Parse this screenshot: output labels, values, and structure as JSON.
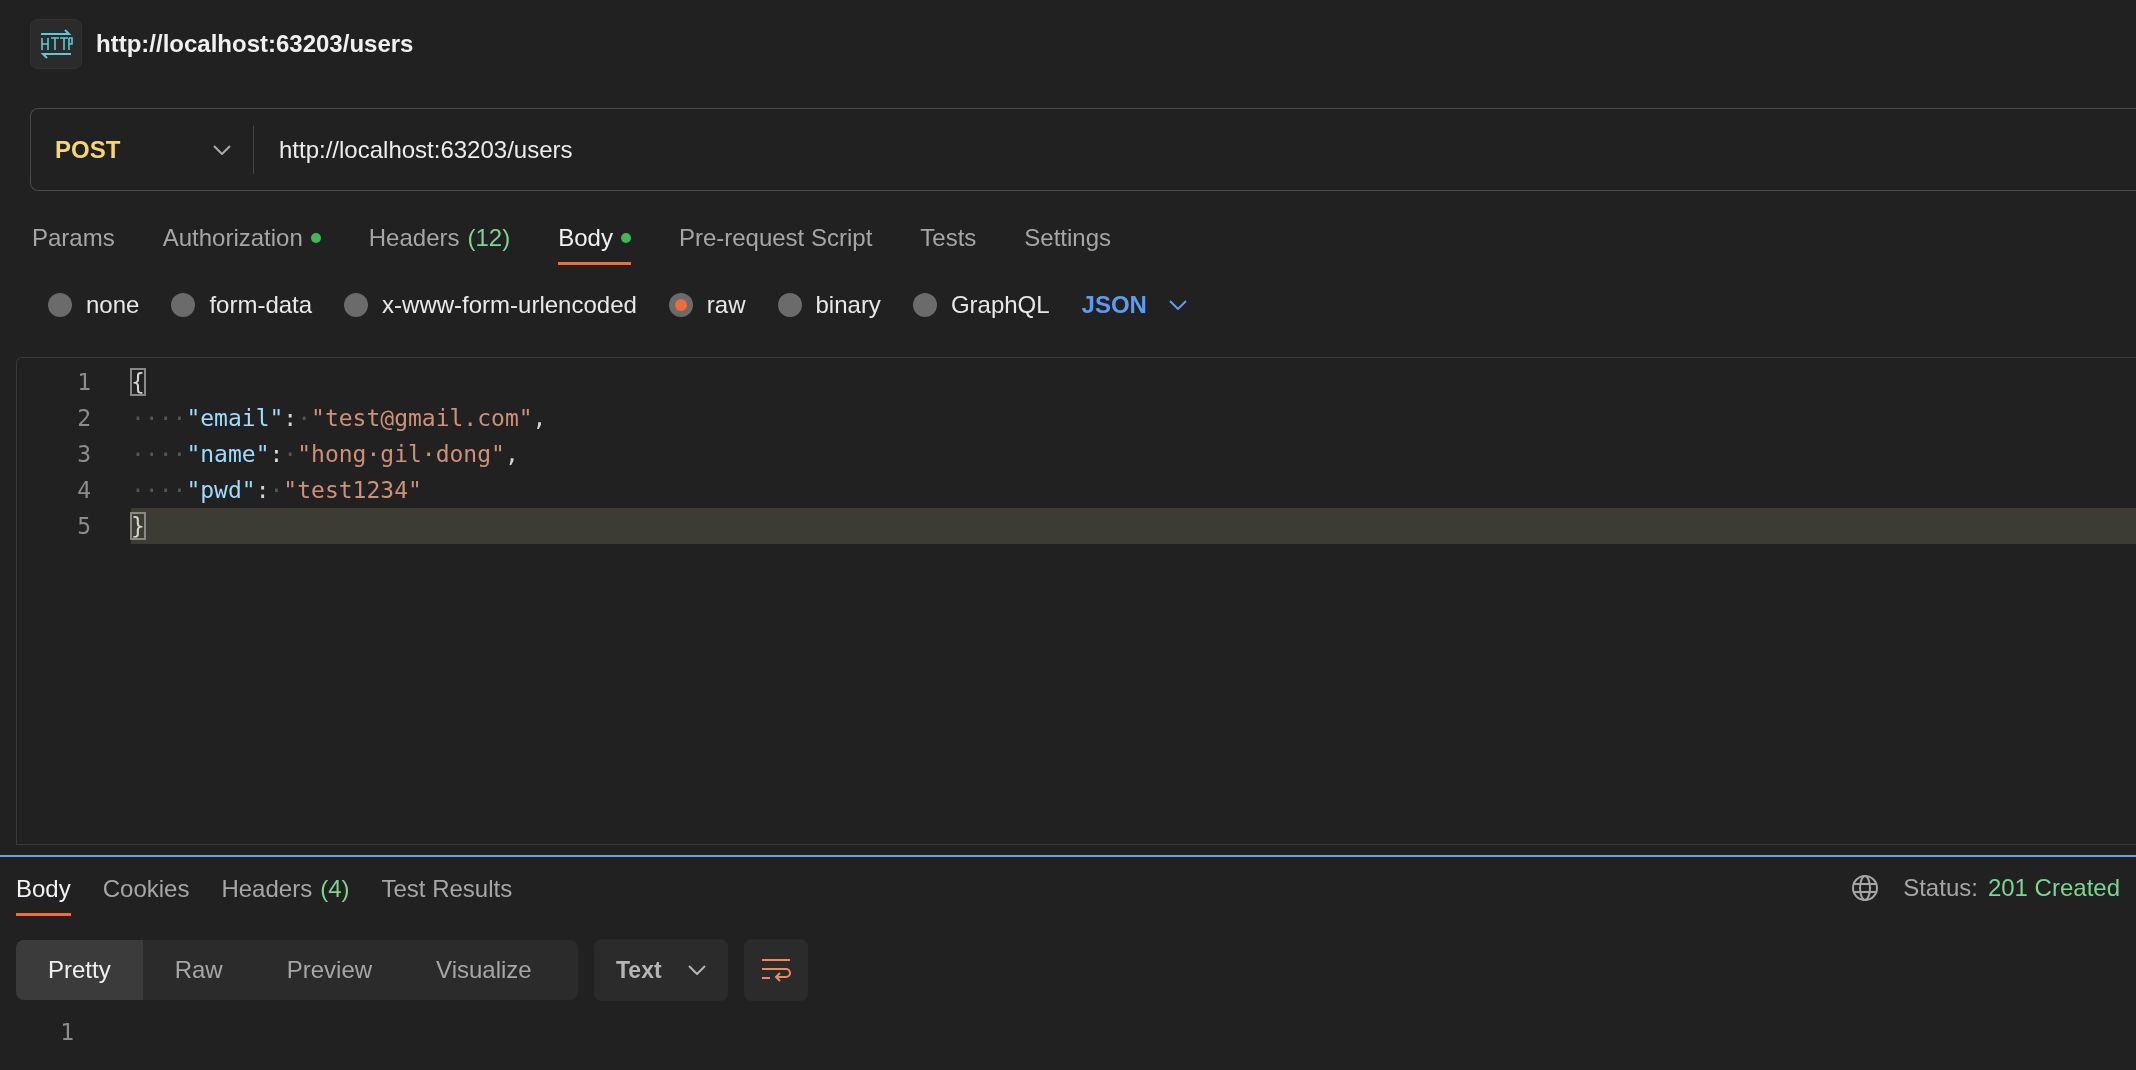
{
  "request": {
    "title": "http://localhost:63203/users",
    "method": "POST",
    "url": "http://localhost:63203/users"
  },
  "tabs": [
    {
      "label": "Params",
      "selected": false,
      "indicator": false
    },
    {
      "label": "Authorization",
      "selected": false,
      "indicator": true
    },
    {
      "label": "Headers",
      "count": "(12)",
      "selected": false,
      "indicator": false
    },
    {
      "label": "Body",
      "selected": true,
      "indicator": true
    },
    {
      "label": "Pre-request Script",
      "selected": false,
      "indicator": false
    },
    {
      "label": "Tests",
      "selected": false,
      "indicator": false
    },
    {
      "label": "Settings",
      "selected": false,
      "indicator": false
    }
  ],
  "body_types": [
    {
      "label": "none",
      "selected": false
    },
    {
      "label": "form-data",
      "selected": false
    },
    {
      "label": "x-www-form-urlencoded",
      "selected": false
    },
    {
      "label": "raw",
      "selected": true
    },
    {
      "label": "binary",
      "selected": false
    },
    {
      "label": "GraphQL",
      "selected": false
    }
  ],
  "body_format": "JSON",
  "editor": {
    "lines": [
      {
        "number": "1",
        "active": false,
        "tokens": [
          {
            "kind": "brace",
            "text": "{",
            "matched": true
          }
        ]
      },
      {
        "number": "2",
        "active": false,
        "tokens": [
          {
            "kind": "space",
            "text": "····"
          },
          {
            "kind": "key",
            "text": "\"email\""
          },
          {
            "kind": "punct",
            "text": ":"
          },
          {
            "kind": "space",
            "text": "·"
          },
          {
            "kind": "string",
            "text": "\"test@gmail.com\""
          },
          {
            "kind": "punct",
            "text": ","
          }
        ]
      },
      {
        "number": "3",
        "active": false,
        "tokens": [
          {
            "kind": "space",
            "text": "····"
          },
          {
            "kind": "key",
            "text": "\"name\""
          },
          {
            "kind": "punct",
            "text": ":"
          },
          {
            "kind": "space",
            "text": "·"
          },
          {
            "kind": "string",
            "text": "\"hong·gil·dong\""
          },
          {
            "kind": "punct",
            "text": ","
          }
        ]
      },
      {
        "number": "4",
        "active": false,
        "tokens": [
          {
            "kind": "space",
            "text": "····"
          },
          {
            "kind": "key",
            "text": "\"pwd\""
          },
          {
            "kind": "punct",
            "text": ":"
          },
          {
            "kind": "space",
            "text": "·"
          },
          {
            "kind": "string",
            "text": "\"test1234\""
          }
        ]
      },
      {
        "number": "5",
        "active": true,
        "tokens": [
          {
            "kind": "brace",
            "text": "}",
            "matched": true
          }
        ]
      }
    ]
  },
  "response": {
    "tabs": [
      {
        "label": "Body",
        "selected": true
      },
      {
        "label": "Cookies",
        "selected": false
      },
      {
        "label": "Headers",
        "count": "(4)",
        "selected": false
      },
      {
        "label": "Test Results",
        "selected": false
      }
    ],
    "status_label": "Status:",
    "status_value": "201 Created",
    "views": [
      {
        "label": "Pretty",
        "selected": true
      },
      {
        "label": "Raw",
        "selected": false
      },
      {
        "label": "Preview",
        "selected": false
      },
      {
        "label": "Visualize",
        "selected": false
      }
    ],
    "format": "Text",
    "line_numbers": [
      "1"
    ]
  }
}
